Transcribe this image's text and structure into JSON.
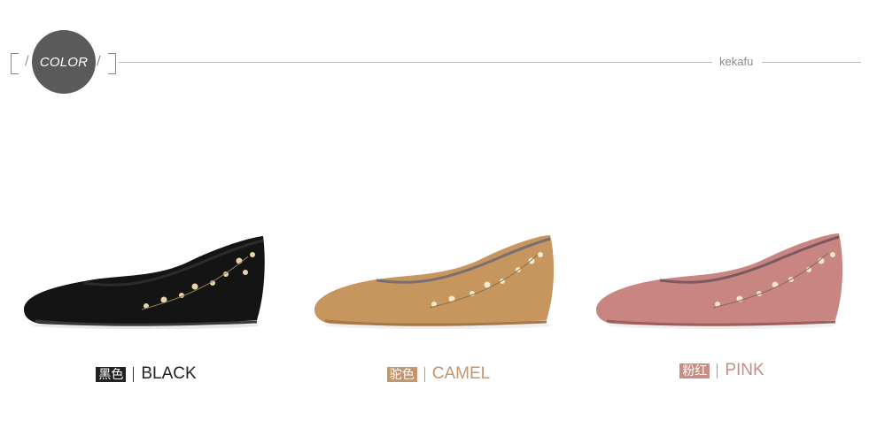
{
  "header": {
    "color_label": "COLOR",
    "brand": "kekafu",
    "slash": "/"
  },
  "products": [
    {
      "cn": "黑色",
      "en": "BLACK",
      "tag_color": "#222222",
      "text_color": "#222222",
      "shoe_color": "#141414"
    },
    {
      "cn": "驼色",
      "en": "CAMEL",
      "tag_color": "#c8946a",
      "text_color": "#c8946a",
      "shoe_color": "#c7955e"
    },
    {
      "cn": "粉红",
      "en": "PINK",
      "tag_color": "#c78e86",
      "text_color": "#c78e86",
      "shoe_color": "#c98582"
    }
  ]
}
